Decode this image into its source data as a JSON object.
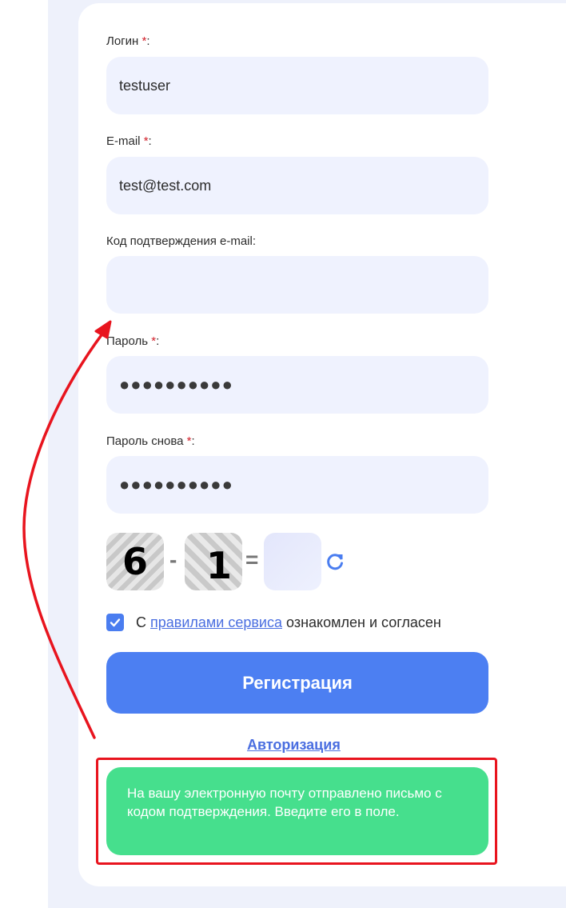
{
  "form": {
    "login": {
      "label": "Логин",
      "required_mark": "*",
      "suffix": ":",
      "value": "testuser"
    },
    "email": {
      "label": "E-mail",
      "required_mark": "*",
      "suffix": ":",
      "value": "test@test.com"
    },
    "email_code": {
      "label": "Код подтверждения e-mail:",
      "value": ""
    },
    "password": {
      "label": "Пароль",
      "required_mark": "*",
      "suffix": ":",
      "value": "●●●●●●●●●●"
    },
    "password_repeat": {
      "label": "Пароль снова",
      "required_mark": "*",
      "suffix": ":",
      "value": "●●●●●●●●●●"
    },
    "captcha": {
      "left": "6",
      "operator": "-",
      "right": "1",
      "equals": "=",
      "answer": ""
    },
    "agreement": {
      "prefix": "С",
      "link": "правилами сервиса",
      "suffix": "ознакомлен и согласен",
      "checked": true
    },
    "register_button": "Регистрация",
    "auth_link": "Авторизация"
  },
  "notice": {
    "text": "На вашу электронную почту отправлено письмо с кодом подтверждения. Введите его в поле."
  },
  "colors": {
    "accent": "#4c7ff2",
    "success": "#46df8d",
    "highlight": "#e8141e",
    "required": "#d2202a"
  }
}
